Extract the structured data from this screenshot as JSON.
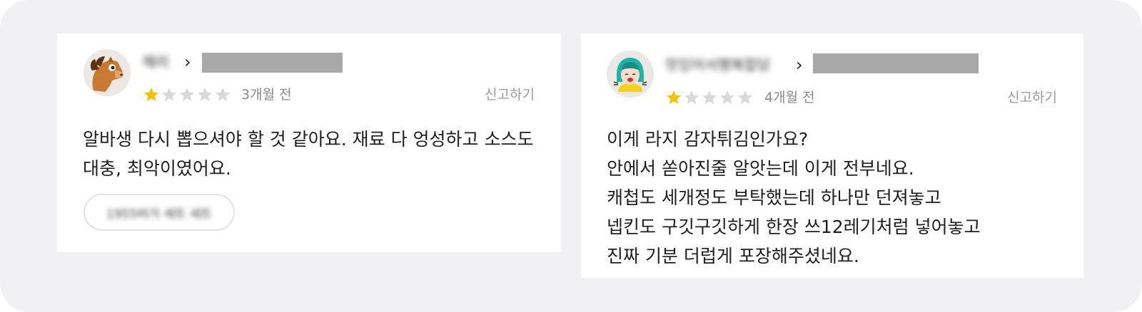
{
  "reviews": [
    {
      "author": "해리",
      "rating": 1,
      "max_rating": 5,
      "date": "3개월 전",
      "report_label": "신고하기",
      "text": "알바생 다시 뽑으셔야 할 것 같아요. 재료 다 엉성하고 소스도 대충, 최악이였어요.",
      "menu_tag": "1955버거 세트 세트",
      "avatar_icon": "horse-avatar-icon"
    },
    {
      "author": "맛있어서행복합당",
      "rating": 1,
      "max_rating": 5,
      "date": "4개월 전",
      "report_label": "신고하기",
      "text": "이게 라지 감자튀김인가요?\n안에서 쏟아진줄 알앗는데 이게 전부네요.\n캐첩도 세개정도 부탁했는데 하나만 던져놓고\n넵킨도 구깃구깃하게 한장 쓰12레기처럼 넣어놓고\n진짜 기분 더럽게 포장해주셨네요.",
      "avatar_icon": "girl-avatar-icon"
    }
  ],
  "colors": {
    "star_filled": "#F5C200",
    "star_empty": "#D9D9D9",
    "background": "#F1F1F3",
    "redaction": "#A8A8A8"
  }
}
